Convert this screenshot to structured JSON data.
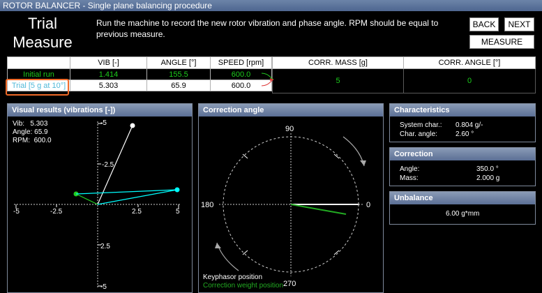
{
  "window": {
    "title": "ROTOR BALANCER - Single plane balancing procedure"
  },
  "header": {
    "title_line1": "Trial",
    "title_line2": "Measure",
    "instructions": "Run the machine to record the new rotor vibration and phase angle. RPM should be equal to previous measure."
  },
  "buttons": {
    "back": "BACK",
    "next": "NEXT",
    "measure": "MEASURE"
  },
  "measure_table": {
    "headers": [
      "",
      "VIB [-]",
      "ANGLE [°]",
      "SPEED [rpm]"
    ],
    "rows": [
      {
        "label": "Initial run",
        "vib": "1.414",
        "angle": "155.5",
        "speed": "600.0"
      },
      {
        "label": "Trial [5 g at 10°]",
        "vib": "5.303",
        "angle": "65.9",
        "speed": "600.0"
      }
    ]
  },
  "correction_table": {
    "headers": [
      "CORR. MASS [g]",
      "CORR. ANGLE [°]"
    ],
    "rows": [
      {
        "mass": "5",
        "angle": "0"
      },
      {
        "mass": "",
        "angle": ""
      }
    ]
  },
  "visual": {
    "title": "Visual results (vibrations [-])",
    "vib_label": "Vib:",
    "vib_value": "5.303",
    "angle_label": "Angle:",
    "angle_value": "65.9",
    "rpm_label": "RPM:",
    "rpm_value": "600.0",
    "x_ticks": [
      "-5",
      "-2.5",
      "2.5",
      "5"
    ],
    "y_ticks": [
      "-5",
      "-2.5",
      "2.5",
      "-5"
    ],
    "colors": {
      "trial": "#ffffff",
      "initial": "#22cc22",
      "difference": "#00ffff"
    }
  },
  "correction_angle": {
    "title": "Correction angle",
    "labels": {
      "top": "90",
      "right": "0",
      "bottom": "270",
      "left": "180"
    },
    "legend_keyphasor": "Keyphasor position",
    "legend_weight": "Correction weight position",
    "colors": {
      "keyphasor": "#ffffff",
      "weight": "#22aa22"
    }
  },
  "characteristics": {
    "title": "Characteristics",
    "system_label": "System char.:",
    "system_value": "0.804 g/-",
    "angle_label": "Char. angle:",
    "angle_value": "2.60 °"
  },
  "correction": {
    "title": "Correction",
    "angle_label": "Angle:",
    "angle_value": "350.0 °",
    "mass_label": "Mass:",
    "mass_value": "2.000 g"
  },
  "unbalance": {
    "title": "Unbalance",
    "value": "6.00 g*mm"
  }
}
